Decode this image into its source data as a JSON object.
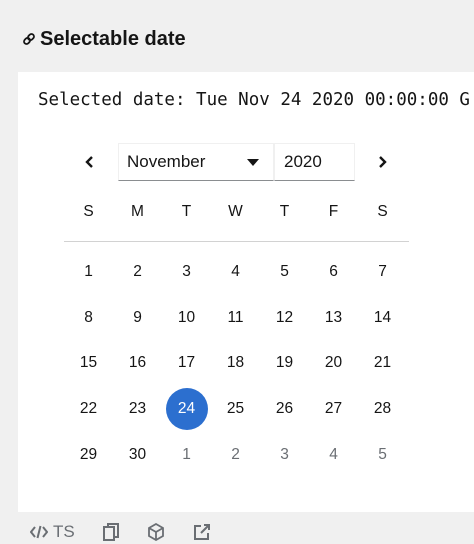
{
  "heading": {
    "title": "Selectable date"
  },
  "selected_text": "Selected date: Tue Nov 24 2020 00:00:00 G",
  "month_select": {
    "value": "November"
  },
  "year_input": {
    "value": "2020"
  },
  "weekdays": [
    "S",
    "M",
    "T",
    "W",
    "T",
    "F",
    "S"
  ],
  "weeks": [
    [
      "1",
      "2",
      "3",
      "4",
      "5",
      "6",
      "7"
    ],
    [
      "8",
      "9",
      "10",
      "11",
      "12",
      "13",
      "14"
    ],
    [
      "15",
      "16",
      "17",
      "18",
      "19",
      "20",
      "21"
    ],
    [
      "22",
      "23",
      "24",
      "25",
      "26",
      "27",
      "28"
    ],
    [
      "29",
      "30",
      "1",
      "2",
      "3",
      "4",
      "5"
    ]
  ],
  "selected_day": "24",
  "colors": {
    "accent": "#2c6fcf",
    "muted": "#6a6e73",
    "text": "#151515"
  },
  "toolbar": {
    "ts_label": "TS",
    "icons": [
      "code-icon",
      "copy-icon",
      "codesandbox-icon",
      "external-link-icon"
    ]
  }
}
